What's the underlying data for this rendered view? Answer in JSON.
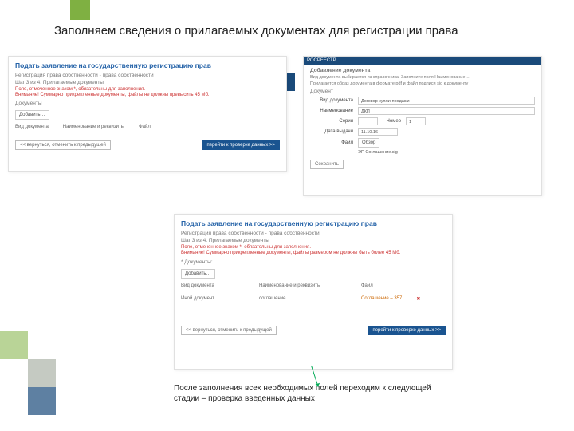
{
  "slide_title": "Заполняем сведения о прилагаемых документах для регистрации права",
  "footer_note": "После заполнения всех необходимых полей переходим к следующей стадии – проверка введенных данных",
  "shot_a": {
    "title": "Подать заявление на государственную регистрацию прав",
    "sub1": "Регистрация права собственности - права собственности",
    "sub2": "Шаг 3 из 4. Прилагаемые документы",
    "warn1": "Поле, отмеченное знаком *, обязательны для заполнения.",
    "warn2": "Внимание! Суммарно прикрепленные документы, файлы не должны превысить 45 Мб.",
    "doc_label": "Документы",
    "add_btn": "Добавить…",
    "col1": "Вид документа",
    "col2": "Наименование и реквизиты",
    "col3": "Файл",
    "back": "<< вернуться, отменить к предыдущей",
    "next": "перейти к проверке данных >>"
  },
  "shot_b": {
    "top": "РОСРЕЕСТР",
    "title": "Добавление документа",
    "hint": "Вид документа выбирается из справочника. Заполните поля Наименование…",
    "hint2": "Прилагается образ документа в формате pdf и файл подписи sig к документу",
    "doc_label": "Документ",
    "f1_lbl": "Вид документа",
    "f1_val": "Договор купли-продажи",
    "f2_lbl": "Наименование",
    "f2_val": "ДКП",
    "f3_lbl": "Серия",
    "f3_val": "",
    "f3b_lbl": "Номер",
    "f3b_val": "1",
    "f4_lbl": "Дата выдачи",
    "f4_val": "11.10.16",
    "f5_lbl": "Файл",
    "f5_btn": "Обзор",
    "f6_lbl": " ",
    "f6_val": "ЭП  Соглашение.sig",
    "save": "Сохранить"
  },
  "shot_c": {
    "title": "Подать заявление на государственную регистрацию прав",
    "sub1": "Регистрация права собственности - права собственности",
    "sub2": "Шаг 3 из 4. Прилагаемые документы",
    "warn1": "Поле, отмеченное знаком *, обязательны для заполнения.",
    "warn2": "Внимание! Суммарно прикрепленные документы, файлы размером не должны быть более 45 Мб.",
    "doc_label": "* Документы:",
    "add_btn": "Добавить…",
    "col1": "Вид документа",
    "col2": "Наименование и реквизиты",
    "col3": "Файл",
    "row_a": "Иной документ",
    "row_b": "соглашение",
    "row_c": "Соглашение – 357",
    "back": "<< вернуться, отменить к предыдущей",
    "next": "перейти к проверке данных >>"
  }
}
